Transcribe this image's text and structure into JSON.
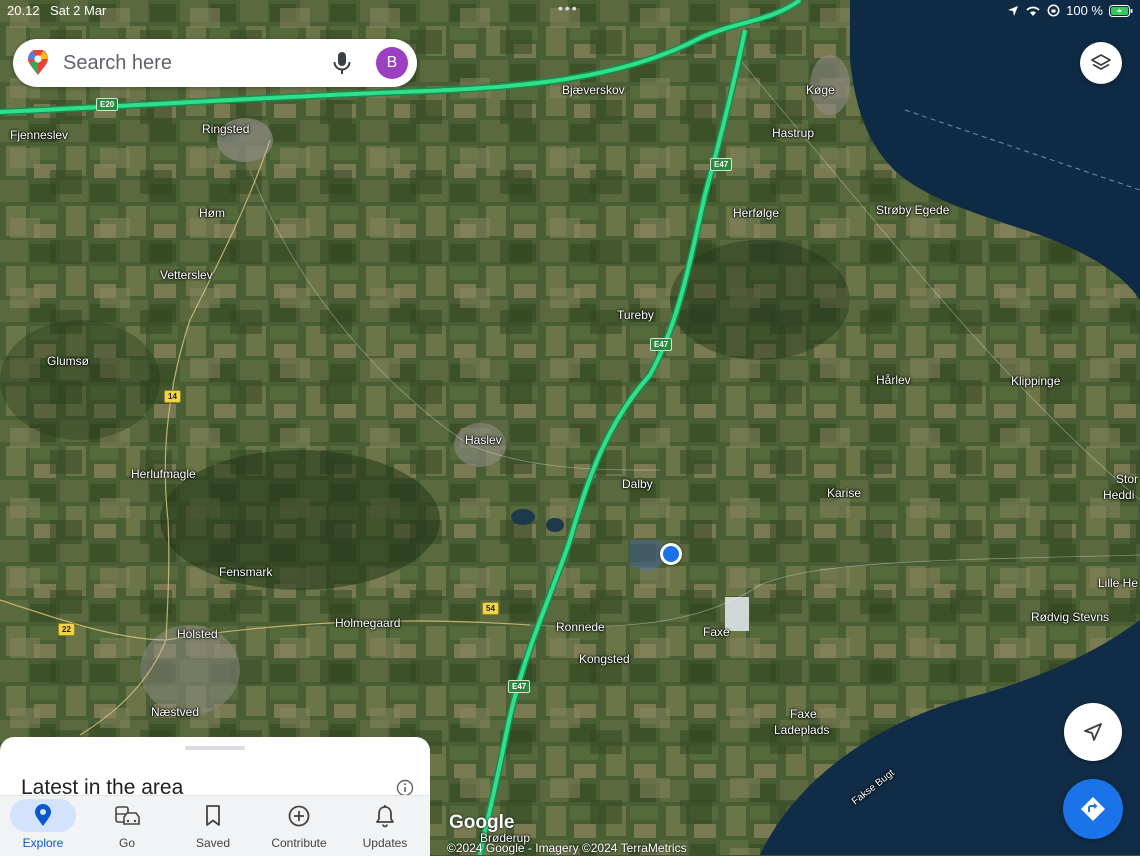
{
  "status_bar": {
    "time": "20.12",
    "date": "Sat 2 Mar",
    "battery": "100 %"
  },
  "search": {
    "placeholder": "Search here",
    "avatar_letter": "B"
  },
  "map": {
    "places": [
      {
        "name": "Fjenneslev"
      },
      {
        "name": "Ringsted"
      },
      {
        "name": "Bjæverskov"
      },
      {
        "name": "Køge"
      },
      {
        "name": "Hastrup"
      },
      {
        "name": "Herfølge"
      },
      {
        "name": "Strøby Egede"
      },
      {
        "name": "Høm"
      },
      {
        "name": "Vetterslev"
      },
      {
        "name": "Tureby"
      },
      {
        "name": "Glumsø"
      },
      {
        "name": "Hårlev"
      },
      {
        "name": "Klippinge"
      },
      {
        "name": "Haslev"
      },
      {
        "name": "Herlufmagle"
      },
      {
        "name": "Dalby"
      },
      {
        "name": "Karise"
      },
      {
        "name": "Stor"
      },
      {
        "name": "Heddi"
      },
      {
        "name": "Fensmark"
      },
      {
        "name": "Lille He"
      },
      {
        "name": "Holmegaard"
      },
      {
        "name": "Ronnede"
      },
      {
        "name": "Rødvig Stevns"
      },
      {
        "name": "Holsted"
      },
      {
        "name": "Faxe"
      },
      {
        "name": "Kongsted"
      },
      {
        "name": "Næstved"
      },
      {
        "name": "Faxe"
      },
      {
        "name": "Ladeplads"
      },
      {
        "name": "Fakse Bugt"
      },
      {
        "name": "Brøderup"
      }
    ],
    "shields": [
      {
        "label": "E20"
      },
      {
        "label": "E47"
      },
      {
        "label": "E47"
      },
      {
        "label": "E47"
      },
      {
        "label": "14"
      },
      {
        "label": "54"
      },
      {
        "label": "22"
      }
    ],
    "google_logo": "Google",
    "copyright": "©2024 Google - Imagery ©2024 TerraMetrics"
  },
  "sheet": {
    "title": "Latest in the area"
  },
  "nav": {
    "items": [
      {
        "label": "Explore"
      },
      {
        "label": "Go"
      },
      {
        "label": "Saved"
      },
      {
        "label": "Contribute"
      },
      {
        "label": "Updates"
      }
    ]
  },
  "colors": {
    "route": "#2ee08a",
    "accent": "#1a73e8",
    "avatar": "#9c3fc1",
    "sea": "#0f2a44"
  }
}
